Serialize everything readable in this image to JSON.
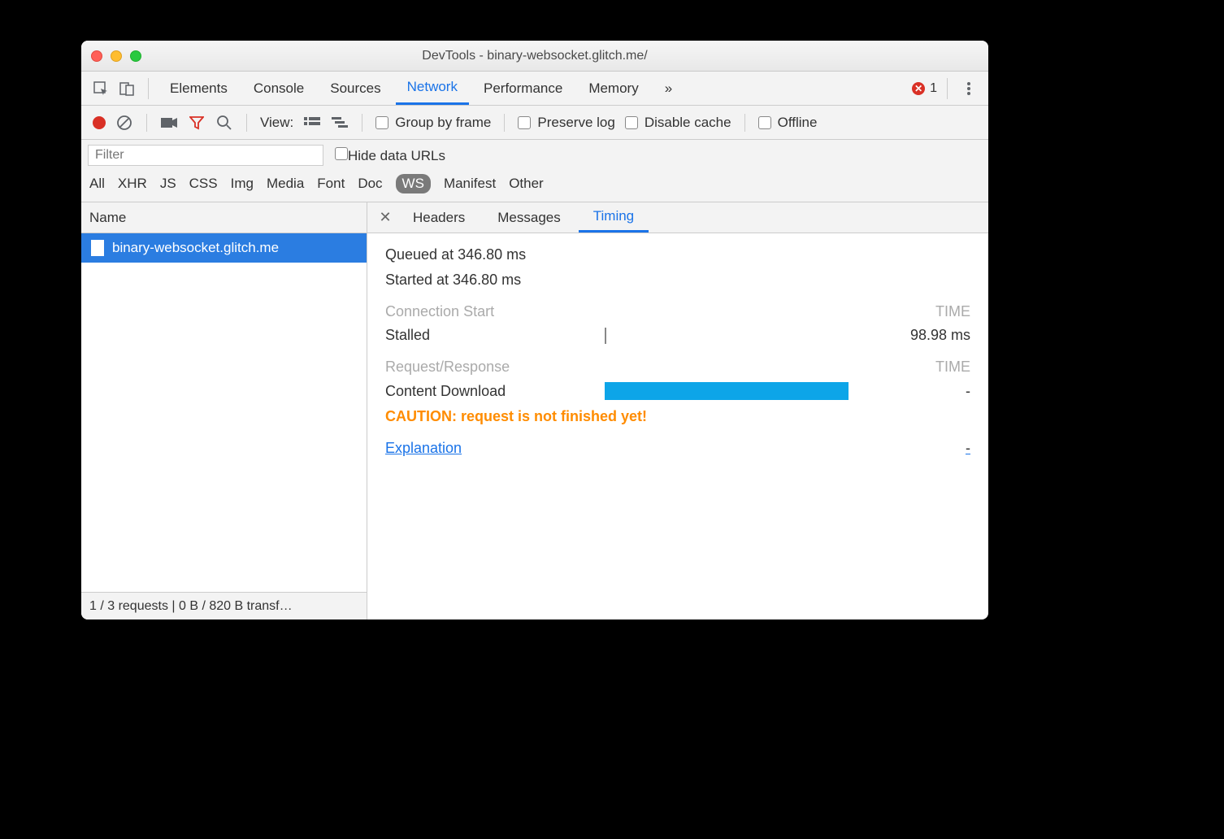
{
  "window": {
    "title": "DevTools - binary-websocket.glitch.me/"
  },
  "main_tabs": {
    "items": [
      "Elements",
      "Console",
      "Sources",
      "Network",
      "Performance",
      "Memory"
    ],
    "active": "Network",
    "overflow_glyph": "»",
    "error_count": "1"
  },
  "toolbar": {
    "view_label": "View:",
    "group_by_frame": "Group by frame",
    "preserve_log": "Preserve log",
    "disable_cache": "Disable cache",
    "offline": "Offline"
  },
  "filter": {
    "placeholder": "Filter",
    "hide_data_urls": "Hide data URLs",
    "types": [
      "All",
      "XHR",
      "JS",
      "CSS",
      "Img",
      "Media",
      "Font",
      "Doc",
      "WS",
      "Manifest",
      "Other"
    ],
    "active_type": "WS"
  },
  "left": {
    "header": "Name",
    "requests": [
      {
        "name": "binary-websocket.glitch.me",
        "selected": true
      }
    ],
    "status": "1 / 3 requests | 0 B / 820 B transf…"
  },
  "detail_tabs": {
    "items": [
      "Headers",
      "Messages",
      "Timing"
    ],
    "active": "Timing"
  },
  "timing": {
    "queued": "Queued at 346.80 ms",
    "started": "Started at 346.80 ms",
    "section1_label": "Connection Start",
    "time_header": "TIME",
    "stalled_label": "Stalled",
    "stalled_value": "98.98 ms",
    "section2_label": "Request/Response",
    "content_download_label": "Content Download",
    "content_download_value": "-",
    "caution": "CAUTION: request is not finished yet!",
    "explanation_label": "Explanation",
    "explanation_value": "-"
  }
}
